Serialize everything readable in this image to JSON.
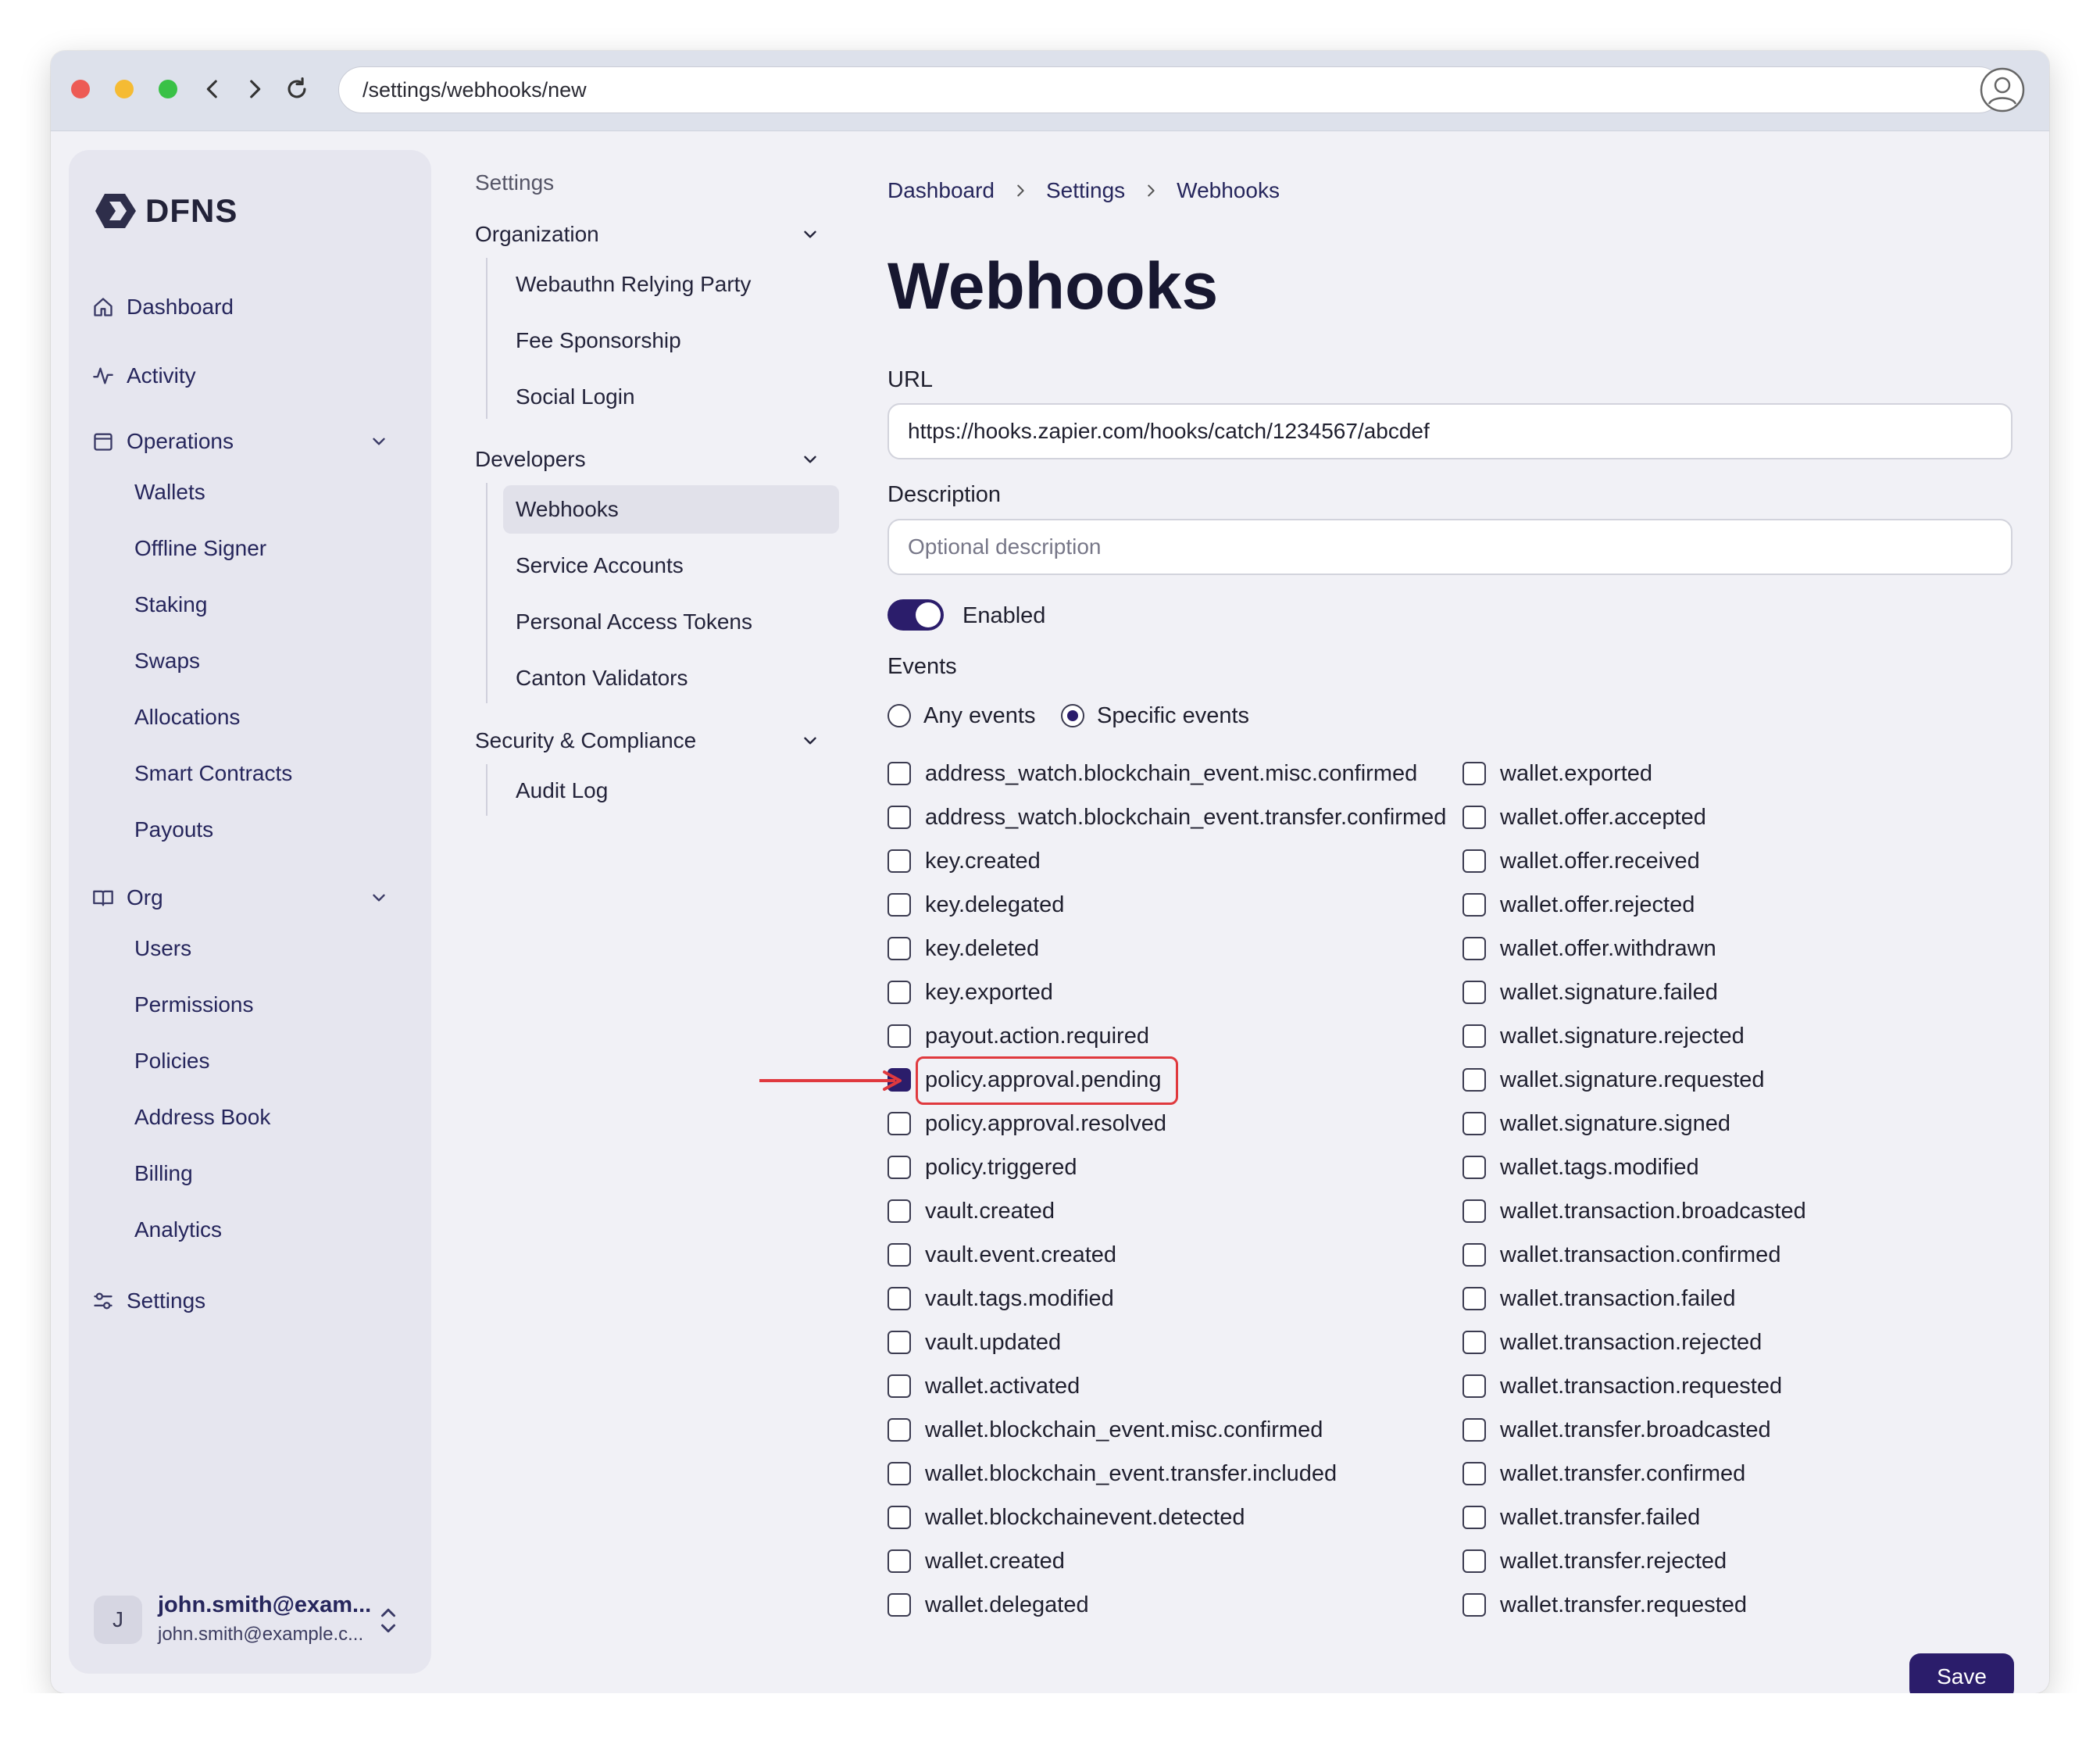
{
  "browser": {
    "url": "/settings/webhooks/new"
  },
  "colors": {
    "accent": "#2b1d6b",
    "highlight": "#e0393e",
    "sidebar_bg": "#e6e6ef",
    "page_bg": "#f1f1f6"
  },
  "sidebar": {
    "brand": "DFNS",
    "items": [
      {
        "label": "Dashboard",
        "icon": "home-icon"
      },
      {
        "label": "Activity",
        "icon": "activity-icon"
      },
      {
        "label": "Operations",
        "icon": "calendar-icon",
        "expanded": true,
        "children": [
          "Wallets",
          "Offline Signer",
          "Staking",
          "Swaps",
          "Allocations",
          "Smart Contracts",
          "Payouts"
        ]
      },
      {
        "label": "Org",
        "icon": "book-icon",
        "expanded": true,
        "children": [
          "Users",
          "Permissions",
          "Policies",
          "Address Book",
          "Billing",
          "Analytics"
        ]
      },
      {
        "label": "Settings",
        "icon": "sliders-icon"
      }
    ],
    "user": {
      "initial": "J",
      "name": "john.smith@exam...",
      "email": "john.smith@example.c..."
    }
  },
  "settings_nav": {
    "title": "Settings",
    "sections": [
      {
        "label": "Organization",
        "items": [
          "Webauthn Relying Party",
          "Fee Sponsorship",
          "Social Login"
        ]
      },
      {
        "label": "Developers",
        "items": [
          "Webhooks",
          "Service Accounts",
          "Personal Access Tokens",
          "Canton Validators"
        ],
        "active": "Webhooks"
      },
      {
        "label": "Security & Compliance",
        "items": [
          "Audit Log"
        ]
      }
    ]
  },
  "breadcrumb": [
    "Dashboard",
    "Settings",
    "Webhooks"
  ],
  "page": {
    "title": "Webhooks",
    "url_label": "URL",
    "url_value": "https://hooks.zapier.com/hooks/catch/1234567/abcdef",
    "description_label": "Description",
    "description_placeholder": "Optional description",
    "enabled_label": "Enabled",
    "enabled": true,
    "events_label": "Events",
    "radio_any": "Any events",
    "radio_specific": "Specific events",
    "selected_mode": "specific",
    "save_label": "Save"
  },
  "events": {
    "left": [
      "address_watch.blockchain_event.misc.confirmed",
      "address_watch.blockchain_event.transfer.confirmed",
      "key.created",
      "key.delegated",
      "key.deleted",
      "key.exported",
      "payout.action.required",
      "policy.approval.pending",
      "policy.approval.resolved",
      "policy.triggered",
      "vault.created",
      "vault.event.created",
      "vault.tags.modified",
      "vault.updated",
      "wallet.activated",
      "wallet.blockchain_event.misc.confirmed",
      "wallet.blockchain_event.transfer.included",
      "wallet.blockchainevent.detected",
      "wallet.created",
      "wallet.delegated"
    ],
    "right": [
      "wallet.exported",
      "wallet.offer.accepted",
      "wallet.offer.received",
      "wallet.offer.rejected",
      "wallet.offer.withdrawn",
      "wallet.signature.failed",
      "wallet.signature.rejected",
      "wallet.signature.requested",
      "wallet.signature.signed",
      "wallet.tags.modified",
      "wallet.transaction.broadcasted",
      "wallet.transaction.confirmed",
      "wallet.transaction.failed",
      "wallet.transaction.rejected",
      "wallet.transaction.requested",
      "wallet.transfer.broadcasted",
      "wallet.transfer.confirmed",
      "wallet.transfer.failed",
      "wallet.transfer.rejected",
      "wallet.transfer.requested"
    ],
    "checked": [
      "policy.approval.pending"
    ]
  }
}
